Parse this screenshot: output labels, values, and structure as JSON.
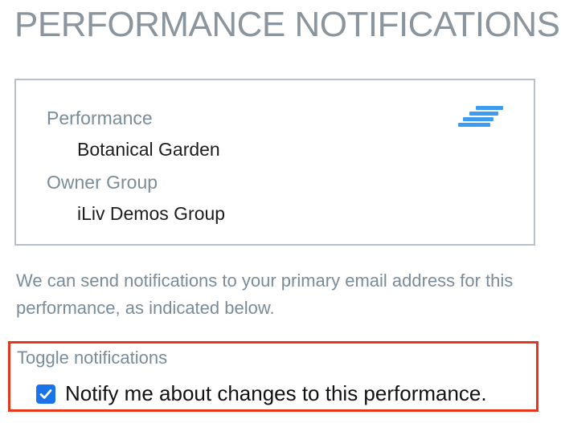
{
  "page": {
    "title": "PERFORMANCE NOTIFICATIONS"
  },
  "card": {
    "performance_label": "Performance",
    "performance_value": "Botanical Garden",
    "owner_group_label": "Owner Group",
    "owner_group_value": "iLiv Demos Group",
    "brand_icon": "stacked-bars-logo",
    "brand_color": "#3b9cf2"
  },
  "intro": {
    "text": "We can send notifications to your primary email address for this performance, as indicated below."
  },
  "notifications": {
    "section_label": "Toggle notifications",
    "option_label": "Notify me about changes to this performance.",
    "checked": true,
    "highlight_color": "#e6361c"
  }
}
